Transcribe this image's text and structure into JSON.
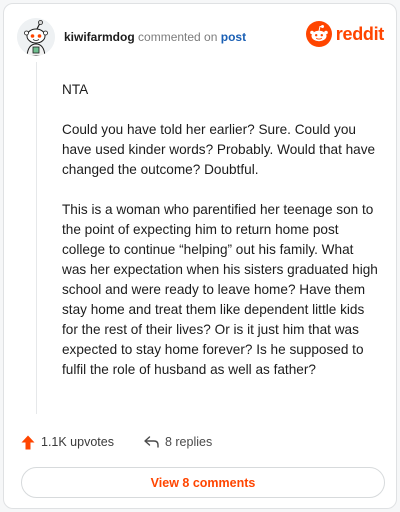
{
  "header": {
    "username": "kiwifarmdog",
    "commented_on": "commented on",
    "post_link": "post",
    "brand_word": "reddit"
  },
  "comment": {
    "paragraphs": [
      "NTA",
      "Could you have told her earlier? Sure. Could you have used kinder words? Probably. Would that have changed the outcome? Doubtful.",
      "This is a woman who parentified her teenage son to the point of expecting him to return home post college to continue “helping” out his family. What was her expectation when his sisters graduated high school and were ready to leave home? Have them stay home and treat them like dependent little kids for the rest of their lives? Or is it just him that was expected to stay home forever? Is he supposed to fulfil the role of husband as well as father?"
    ]
  },
  "actions": {
    "upvotes": "1.1K upvotes",
    "replies": "8 replies"
  },
  "footer": {
    "view_comments": "View 8 comments"
  },
  "colors": {
    "brand": "#ff4500",
    "link": "#1a5fb4"
  },
  "icons": {
    "avatar": "snoo-avatar-icon",
    "logo": "reddit-logo-icon",
    "upvote": "upvote-arrow-icon",
    "reply": "reply-arrow-icon"
  }
}
